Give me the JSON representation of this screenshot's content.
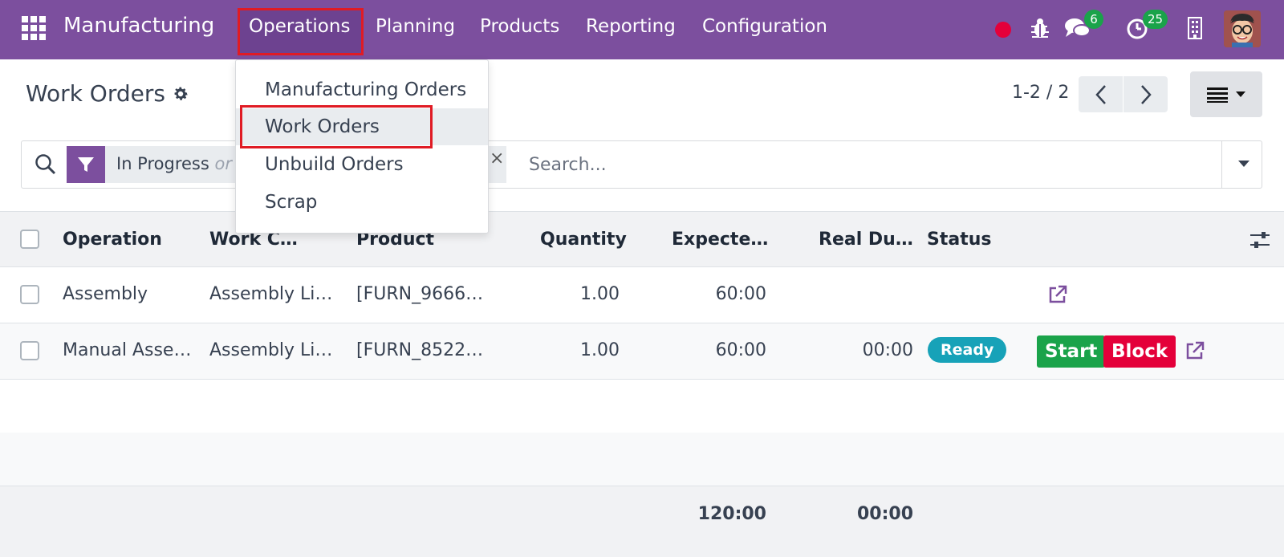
{
  "navbar": {
    "app_name": "Manufacturing",
    "menu": [
      "Operations",
      "Planning",
      "Products",
      "Reporting",
      "Configuration"
    ],
    "chat_count": "6",
    "activity_count": "25",
    "bg_color": "#7c4f9e"
  },
  "dropdown": {
    "items": [
      "Manufacturing Orders",
      "Work Orders",
      "Unbuild Orders",
      "Scrap"
    ]
  },
  "control_panel": {
    "title": "Work Orders",
    "pager": "1-2 / 2"
  },
  "search": {
    "facet_first": "In Progress",
    "facet_or": "or",
    "placeholder": "Search..."
  },
  "table": {
    "columns": [
      "Operation",
      "Work C…",
      "Product",
      "Quantity",
      "Expecte…",
      "Real Du…",
      "Status"
    ],
    "rows": [
      {
        "operation": "Assembly",
        "work_center": "Assembly Li…",
        "product": "[FURN_9666…",
        "quantity": "1.00",
        "expected": "60:00",
        "real": "",
        "status": ""
      },
      {
        "operation": "Manual Asse…",
        "work_center": "Assembly Li…",
        "product": "[FURN_8522…",
        "quantity": "1.00",
        "expected": "60:00",
        "real": "00:00",
        "status": "Ready",
        "start_label": "Start",
        "block_label": "Block"
      }
    ],
    "totals": {
      "expected": "120:00",
      "real": "00:00"
    }
  }
}
